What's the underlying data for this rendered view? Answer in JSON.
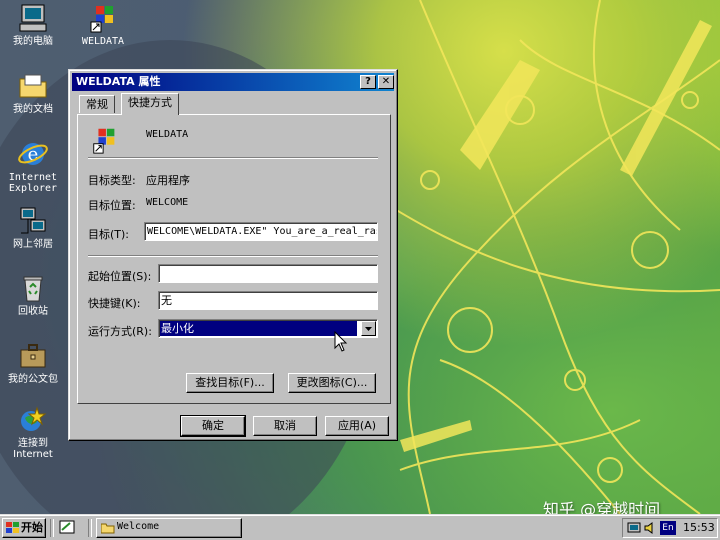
{
  "desktop": {
    "icons": [
      {
        "label": "我的电脑"
      },
      {
        "label": "WELDATA"
      },
      {
        "label": "我的文档"
      },
      {
        "label": "Internet\nExplorer"
      },
      {
        "label": "网上邻居"
      },
      {
        "label": "回收站"
      },
      {
        "label": "我的公文包"
      },
      {
        "label": "连接到\nInternet"
      }
    ],
    "watermark": "知乎 @穿越时间"
  },
  "dialog": {
    "title": "WELDATA 属性",
    "help_button": "?",
    "close_button": "✕",
    "tabs": [
      {
        "label": "常规"
      },
      {
        "label": "快捷方式"
      }
    ],
    "shortcut_name": "WELDATA",
    "target_type_label": "目标类型:",
    "target_type_value": "应用程序",
    "target_location_label": "目标位置:",
    "target_location_value": "WELCOME",
    "target_label": "目标(T):",
    "target_value": "WELCOME\\WELDATA.EXE\" You_are_a_real_rascal",
    "start_in_label": "起始位置(S):",
    "start_in_value": "",
    "shortcut_key_label": "快捷键(K):",
    "shortcut_key_value": "无",
    "run_label": "运行方式(R):",
    "run_value": "最小化",
    "find_target_button": "查找目标(F)...",
    "change_icon_button": "更改图标(C)...",
    "ok_button": "确定",
    "cancel_button": "取消",
    "apply_button": "应用(A)"
  },
  "taskbar": {
    "start_label": "开始",
    "task_label": "Welcome",
    "lang_indicator": "En",
    "clock": "15:53"
  },
  "colors": {
    "title_active": "#000080",
    "face": "#c0c0c0",
    "selection": "#000080"
  }
}
